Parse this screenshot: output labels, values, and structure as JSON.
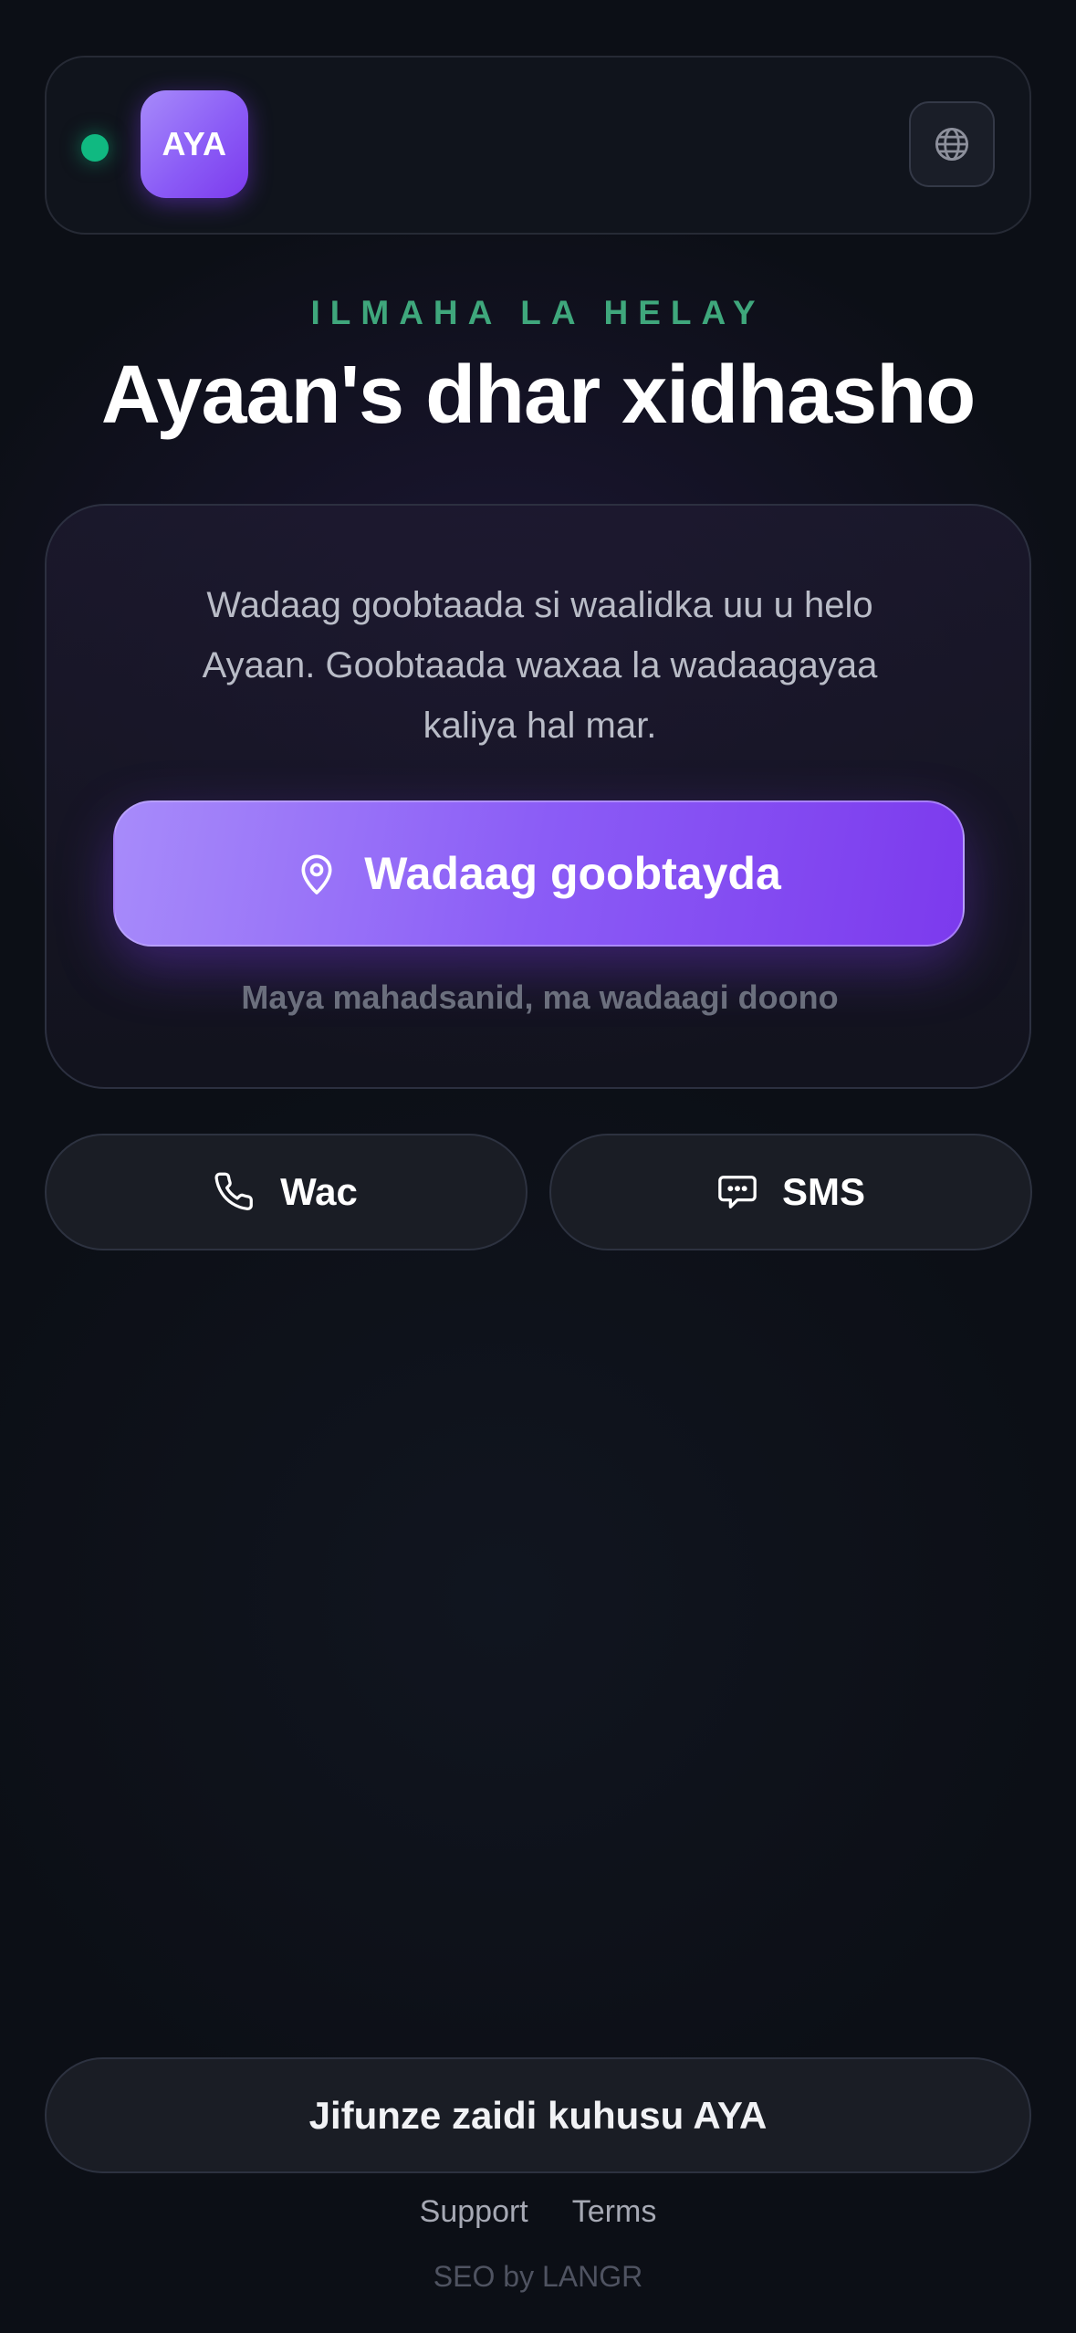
{
  "header": {
    "status": "online",
    "logo_text": "AYA",
    "language_icon": "globe-icon"
  },
  "hero": {
    "eyebrow": "ILMAHA LA HELAY",
    "title": "Ayaan's dhar xidhasho"
  },
  "share_card": {
    "description": "Wadaag goobtaada si waalidka uu u helo Ayaan. Goobtaada waxaa la wadaagayaa kaliya hal mar.",
    "share_button_label": "Wadaag goobtayda",
    "share_button_icon": "location-pin-icon",
    "decline_label": "Maya mahadsanid, ma wadaagi doono"
  },
  "contact": {
    "call_label": "Wac",
    "call_icon": "phone-icon",
    "sms_label": "SMS",
    "sms_icon": "message-icon"
  },
  "footer": {
    "learn_more_label": "Jifunze zaidi kuhusu AYA",
    "links": [
      "Support",
      "Terms"
    ],
    "credit": "SEO by LANGR"
  },
  "colors": {
    "background": "#0c0f16",
    "accent": "#8b5cf6",
    "accent_dark": "#7c3aed",
    "status_green": "#10b981",
    "eyebrow_green": "#3fa77c"
  }
}
